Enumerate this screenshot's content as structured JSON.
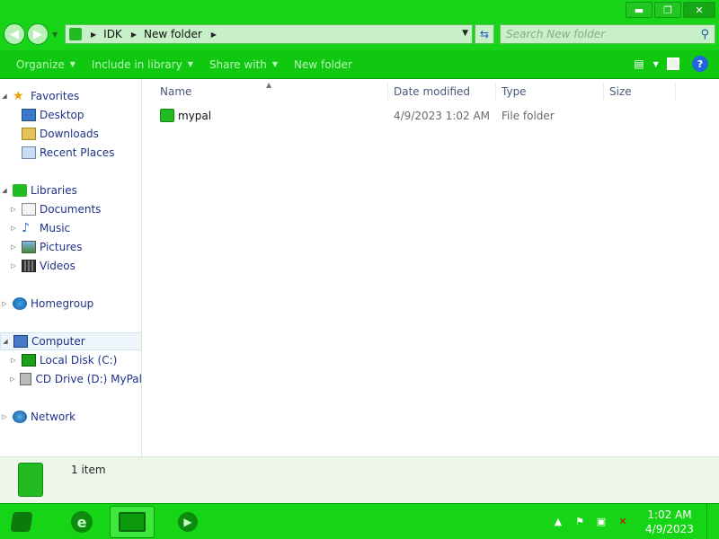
{
  "window": {
    "caption_buttons": {
      "minimize": "▬",
      "restore": "❐",
      "close": "✕"
    }
  },
  "address": {
    "breadcrumbs": [
      "IDK",
      "New folder"
    ]
  },
  "search": {
    "placeholder": "Search New folder"
  },
  "toolbar": {
    "organize": "Organize",
    "include_in_library": "Include in library",
    "share_with": "Share with",
    "new_folder": "New folder"
  },
  "nav": {
    "favorites": "Favorites",
    "desktop": "Desktop",
    "downloads": "Downloads",
    "recent_places": "Recent Places",
    "libraries": "Libraries",
    "documents": "Documents",
    "music": "Music",
    "pictures": "Pictures",
    "videos": "Videos",
    "homegroup": "Homegroup",
    "computer": "Computer",
    "local_disk": "Local Disk (C:)",
    "cd_drive": "CD Drive (D:) MyPal",
    "network": "Network"
  },
  "columns": {
    "name": "Name",
    "date_modified": "Date modified",
    "type": "Type",
    "size": "Size"
  },
  "files": [
    {
      "name": "mypal",
      "date_modified": "4/9/2023 1:02 AM",
      "type": "File folder",
      "size": ""
    }
  ],
  "details": {
    "count": "1 item"
  },
  "taskbar": {
    "time": "1:02 AM",
    "date": "4/9/2023"
  },
  "colors": {
    "accent": "#18d418",
    "taskbar": "#16d416",
    "folder": "#22bb22"
  }
}
